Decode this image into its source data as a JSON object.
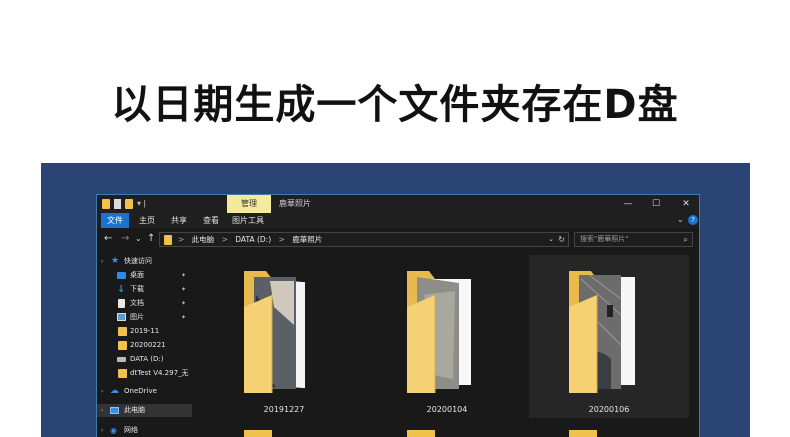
{
  "headline": "以日期生成一个文件夹存在D盘",
  "window": {
    "manage_tab": "管理",
    "title": "鹿華照片",
    "controls": {
      "minimize": "—",
      "maximize": "☐",
      "close": "✕"
    }
  },
  "ribbon": {
    "tabs": [
      "文件",
      "主页",
      "共享",
      "查看",
      "图片工具"
    ],
    "active_tab": "文件",
    "expand_icon": "chevron-down-icon",
    "help_icon": "?"
  },
  "nav": {
    "back": "←",
    "forward": "→",
    "recent": "⌄",
    "up": "↑",
    "breadcrumbs": [
      "此电脑",
      "DATA (D:)",
      "鹿華照片"
    ],
    "separator": ">",
    "dropdown": "⌄",
    "refresh": "↻",
    "search_placeholder": "搜索\"鹿華照片\"",
    "search_icon": "⌕"
  },
  "sidebar": {
    "items": [
      {
        "label": "快速访问",
        "icon": "star-icon",
        "pinned": false
      },
      {
        "label": "桌面",
        "icon": "desktop-icon",
        "pinned": true
      },
      {
        "label": "下载",
        "icon": "download-icon",
        "pinned": true
      },
      {
        "label": "文档",
        "icon": "document-icon",
        "pinned": true
      },
      {
        "label": "图片",
        "icon": "pictures-icon",
        "pinned": true
      },
      {
        "label": "2019-11",
        "icon": "folder-icon",
        "pinned": false
      },
      {
        "label": "20200221",
        "icon": "folder-icon",
        "pinned": false
      },
      {
        "label": "DATA (D:)",
        "icon": "drive-icon",
        "pinned": false
      },
      {
        "label": "dtTest V4.297_无",
        "icon": "folder-icon",
        "pinned": false
      },
      {
        "label": "OneDrive",
        "icon": "cloud-icon",
        "pinned": false
      },
      {
        "label": "此电脑",
        "icon": "computer-icon",
        "pinned": false
      },
      {
        "label": "网络",
        "icon": "network-icon",
        "pinned": false
      }
    ],
    "pin_glyph": "📌",
    "selected": "此电脑"
  },
  "folders": [
    {
      "name": "20191227",
      "hovered": false
    },
    {
      "name": "20200104",
      "hovered": false
    },
    {
      "name": "20200106",
      "hovered": true
    }
  ],
  "colors": {
    "stage_bg": "#2a4573",
    "window_bg": "#191919",
    "accent": "#1a73d0",
    "manage_tab": "#f4ea9e",
    "folder": "#f0c24b"
  }
}
